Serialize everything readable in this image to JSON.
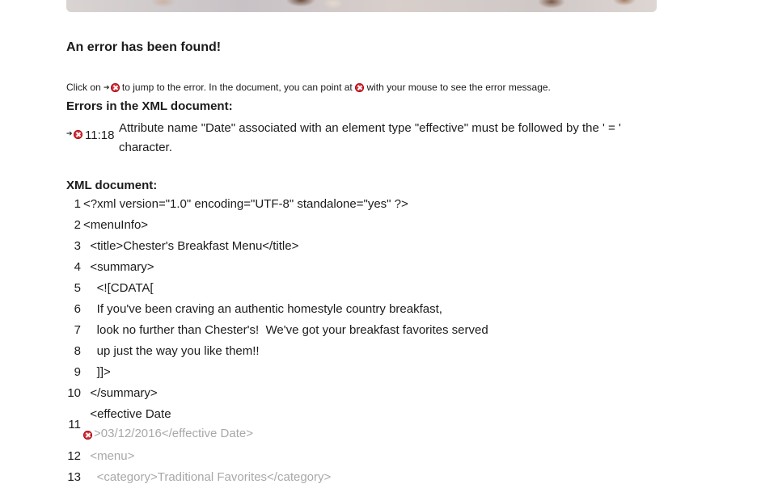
{
  "title": "An error has been found!",
  "hint": {
    "part1": "Click on",
    "part2": "to jump to the error. In the document, you can point at",
    "part3": "with your mouse to see the error message."
  },
  "errors_heading": "Errors in the XML document:",
  "errors": [
    {
      "location": "11:18",
      "message": "Attribute name \"Date\" associated with an element type \"effective\" must be followed by the ' = ' character."
    }
  ],
  "xml_heading": "XML document:",
  "lines": [
    {
      "num": "1",
      "text": "<?xml version=\"1.0\" encoding=\"UTF-8\" standalone=\"yes\" ?>"
    },
    {
      "num": "2",
      "text": "<menuInfo>"
    },
    {
      "num": "3",
      "text": "  <title>Chester's Breakfast Menu</title>"
    },
    {
      "num": "4",
      "text": "  <summary>"
    },
    {
      "num": "5",
      "text": "    <![CDATA["
    },
    {
      "num": "6",
      "text": "    If you've been craving an authentic homestyle country breakfast,"
    },
    {
      "num": "7",
      "text": "    look no further than Chester's!  We've got your breakfast favorites served"
    },
    {
      "num": "8",
      "text": "    up just the way you like them!!"
    },
    {
      "num": "9",
      "text": "    ]]>"
    },
    {
      "num": "10",
      "text": "  </summary>"
    },
    {
      "num": "11",
      "text": "  <effective Date",
      "text_after": ">03/12/2016</effective Date>"
    },
    {
      "num": "12",
      "text": "  <menu>"
    },
    {
      "num": "13",
      "text": "    <category>Traditional Favorites</category>"
    }
  ],
  "colors": {
    "error": "#d9303a",
    "dim_text": "#a8a8a8",
    "text": "#1b1b1b"
  },
  "icons": [
    "error-icon",
    "jump-arrow-icon"
  ]
}
